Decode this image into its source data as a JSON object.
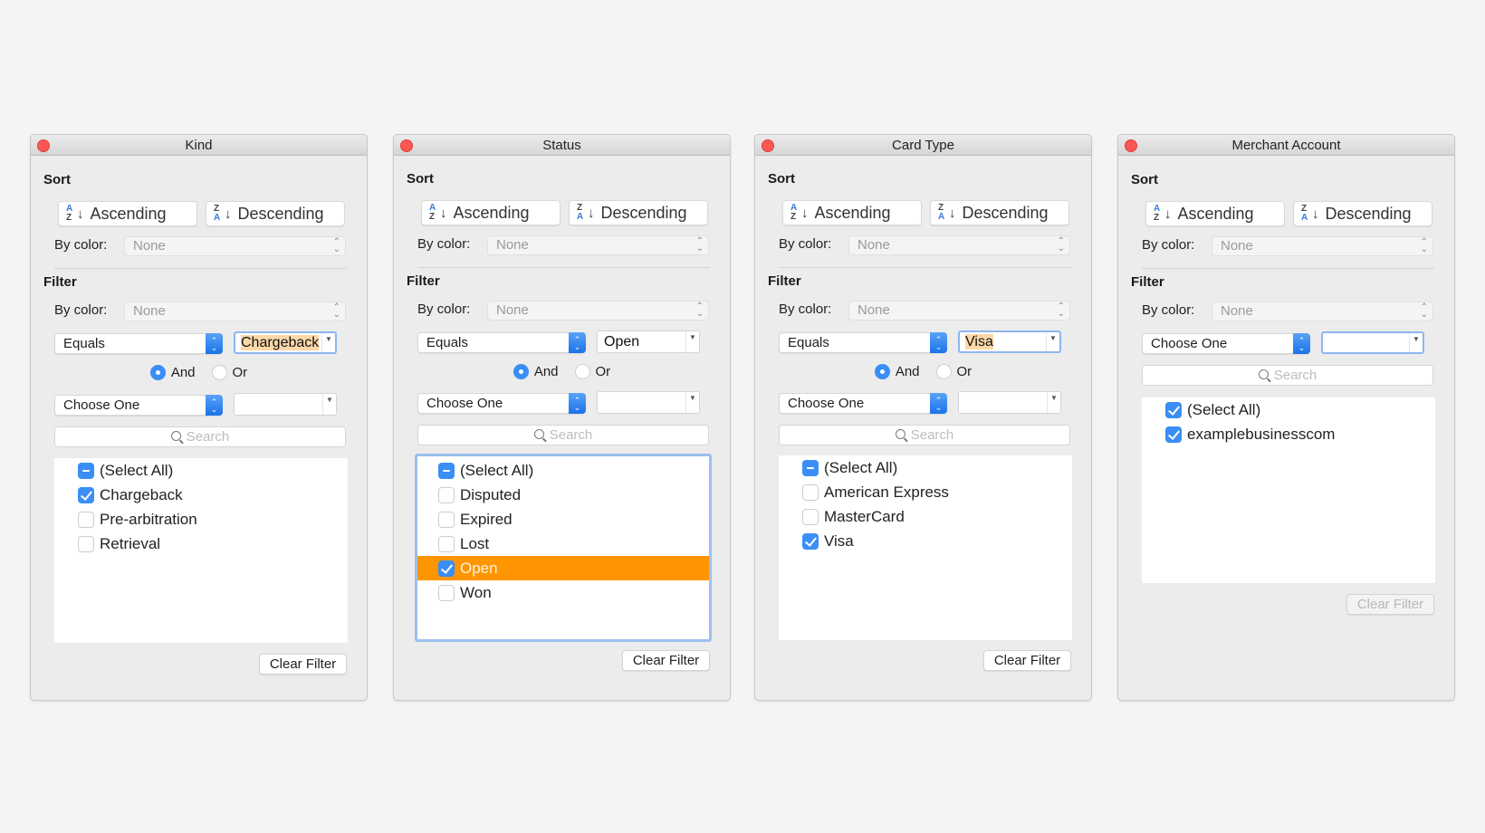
{
  "common": {
    "sort_label": "Sort",
    "ascending": "Ascending",
    "descending": "Descending",
    "by_color_label": "By color:",
    "color_none": "None",
    "filter_label": "Filter",
    "and_label": "And",
    "or_label": "Or",
    "search_placeholder": "Search",
    "clear_filter": "Clear Filter",
    "choose_one": "Choose One",
    "equals": "Equals"
  },
  "colors": {
    "accent": "#3a8ef6",
    "selection": "#ff9500",
    "close_button": "#fc5753",
    "highlight": "#fcd8a8"
  },
  "panels": [
    {
      "title": "Kind",
      "condition1": {
        "operator": "Equals",
        "value": "Chargeback"
      },
      "logic": "And",
      "condition2": {
        "operator": "Choose One",
        "value": ""
      },
      "items": [
        {
          "label": "(Select All)",
          "state": "mixed"
        },
        {
          "label": "Chargeback",
          "state": "checked"
        },
        {
          "label": "Pre-arbitration",
          "state": "unchecked"
        },
        {
          "label": "Retrieval",
          "state": "unchecked"
        }
      ],
      "clear_enabled": true
    },
    {
      "title": "Status",
      "condition1": {
        "operator": "Equals",
        "value": "Open"
      },
      "logic": "And",
      "condition2": {
        "operator": "Choose One",
        "value": ""
      },
      "items": [
        {
          "label": "(Select All)",
          "state": "mixed"
        },
        {
          "label": "Disputed",
          "state": "unchecked"
        },
        {
          "label": "Expired",
          "state": "unchecked"
        },
        {
          "label": "Lost",
          "state": "unchecked"
        },
        {
          "label": "Open",
          "state": "checked",
          "selected": true
        },
        {
          "label": "Won",
          "state": "unchecked"
        }
      ],
      "clear_enabled": true
    },
    {
      "title": "Card Type",
      "condition1": {
        "operator": "Equals",
        "value": "Visa"
      },
      "logic": "And",
      "condition2": {
        "operator": "Choose One",
        "value": ""
      },
      "items": [
        {
          "label": "(Select All)",
          "state": "mixed"
        },
        {
          "label": "American Express",
          "state": "unchecked"
        },
        {
          "label": "MasterCard",
          "state": "unchecked"
        },
        {
          "label": "Visa",
          "state": "checked"
        }
      ],
      "clear_enabled": true
    },
    {
      "title": "Merchant Account",
      "condition1": {
        "operator": "Choose One",
        "value": ""
      },
      "items": [
        {
          "label": "(Select All)",
          "state": "checked"
        },
        {
          "label": "examplebusinesscom",
          "state": "checked"
        }
      ],
      "clear_enabled": false
    }
  ]
}
